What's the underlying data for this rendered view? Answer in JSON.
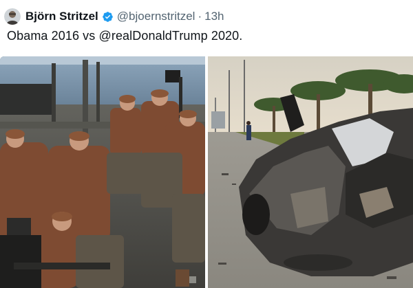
{
  "tweet": {
    "author_name": "Björn Stritzel",
    "author_handle": "@bjoernstritzel",
    "separator": "·",
    "time": "13h",
    "text": "Obama 2016 vs @realDonaldTrump 2020."
  },
  "icons": {
    "verified": "verified-badge-icon",
    "avatar": "profile-avatar"
  },
  "colors": {
    "verified_blue": "#1d9bf0",
    "secondary_text": "#536471",
    "primary_text": "#0f1419"
  }
}
